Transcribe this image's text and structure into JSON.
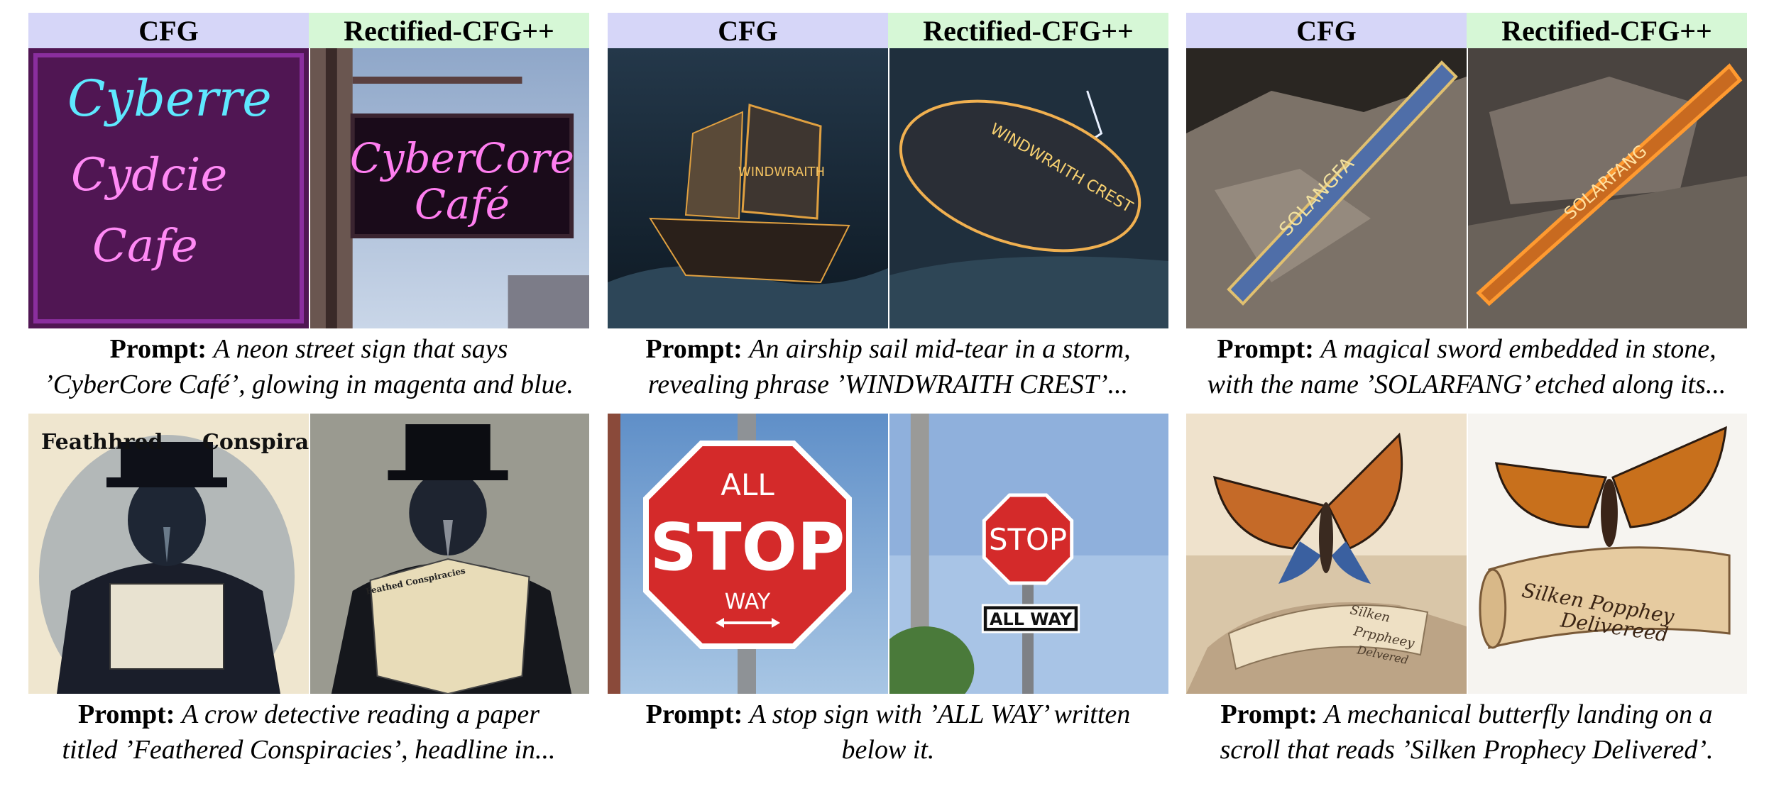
{
  "headers": {
    "cfg": "CFG",
    "rect": "Rectified-CFG++"
  },
  "prompt_label": "Prompt:",
  "panels": [
    {
      "line1": "A neon street sign that says",
      "line2": "’CyberCore Café’, glowing in magenta and blue.",
      "left_text": [
        "Cyberre",
        "Cydcie",
        "Cafe"
      ],
      "right_text": [
        "CyberCore",
        "Café"
      ]
    },
    {
      "line1": "An airship sail mid-tear in a storm,",
      "line2": "revealing phrase ’WINDWRAITH CREST’...",
      "left_text": [
        "WINDWRAITH"
      ],
      "right_text": [
        "WINDWRAITH CREST"
      ]
    },
    {
      "line1": "A magical sword embedded in stone,",
      "line2": "with the name ’SOLARFANG’ etched along its...",
      "left_text": [
        "SOLANGFA"
      ],
      "right_text": [
        "SOLARFANG"
      ]
    },
    {
      "line1": "A crow detective reading a paper",
      "line2": "titled ’Feathered Conspiracies’, headline in...",
      "left_text": [
        "Feathhred",
        "Conspiracies"
      ],
      "right_text": [
        "Feathed Conspiracies"
      ]
    },
    {
      "line1": "A stop sign with ’ALL WAY’ written",
      "line2": "below it.",
      "left_text": [
        "ALL",
        "STOP",
        "WAY"
      ],
      "right_text": [
        "STOP",
        "ALL WAY"
      ]
    },
    {
      "line1": "A mechanical butterfly landing on a",
      "line2": "scroll that reads ’Silken Prophecy Delivered’.",
      "left_text": [
        "Silken",
        "Prppheey",
        "Delvered"
      ],
      "right_text": [
        "Silken Popphey",
        "Delivereed"
      ]
    }
  ]
}
